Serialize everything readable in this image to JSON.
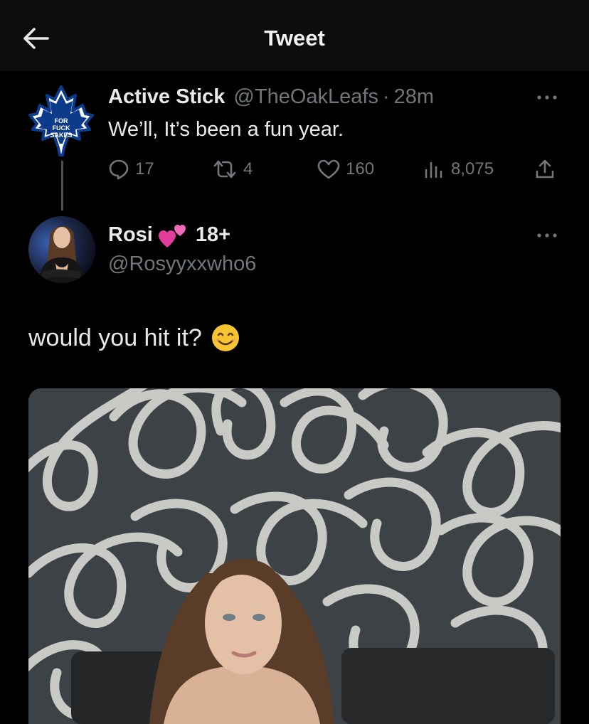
{
  "header": {
    "title": "Tweet"
  },
  "parent_tweet": {
    "avatar_text": [
      "FOR",
      "FUCK",
      "SAKES"
    ],
    "display_name": "Active Stick",
    "handle": "@TheOakLeafs",
    "separator": "·",
    "time": "28m",
    "text": "We’ll, It’s been a fun year.",
    "stats": {
      "replies": "17",
      "retweets": "4",
      "likes": "160",
      "views": "8,075"
    }
  },
  "reply_tweet": {
    "display_name": "Rosi",
    "tag": "18+",
    "handle": "@Rosyyxxwho6",
    "text": "would you hit it?"
  },
  "colors": {
    "background": "#000000",
    "secondary_text": "#71767b",
    "primary_text": "#e7e9ea",
    "leafs_blue": "#0c3b8c"
  }
}
